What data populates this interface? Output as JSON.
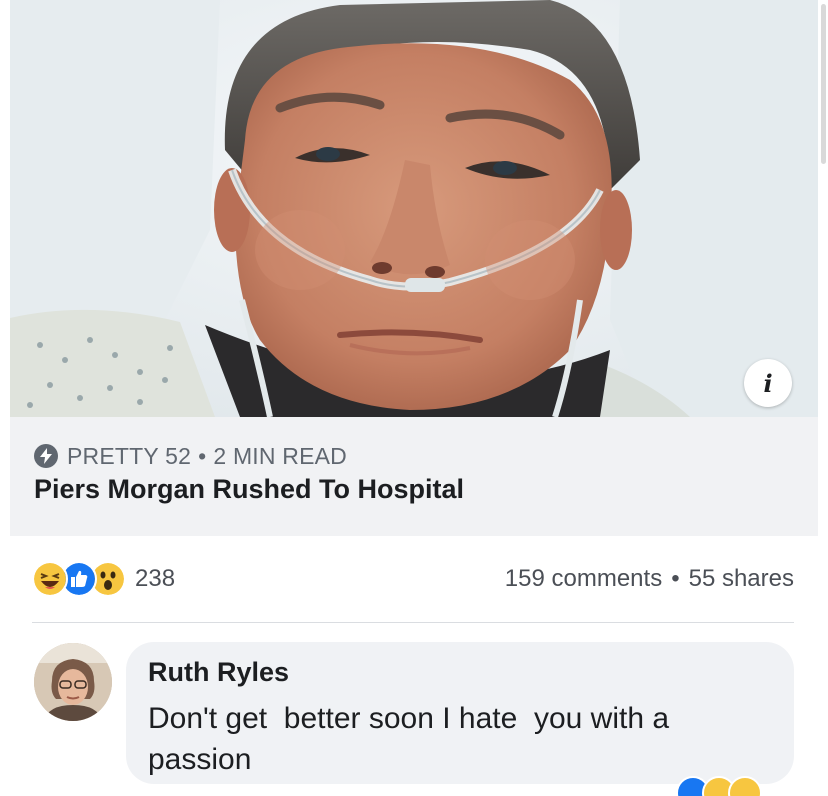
{
  "link_preview": {
    "source": "PRETTY 52",
    "separator": "•",
    "read_time": "2 MIN READ",
    "headline": "Piers Morgan Rushed To Hospital",
    "info_glyph": "i",
    "source_icon": "lightning-bolt-icon"
  },
  "reactions": {
    "icons": [
      "haha-emoji-icon",
      "like-thumb-icon",
      "wow-emoji-icon"
    ],
    "count": "238"
  },
  "stats": {
    "comments": "159 comments",
    "separator": "•",
    "shares": "55 shares"
  },
  "comment": {
    "author": "Ruth Ryles",
    "text": "Don't get  better soon I hate  you with a\npassion",
    "reaction_icons": [
      "like-thumb-icon",
      "haha-emoji-icon",
      "wow-emoji-icon"
    ]
  },
  "colors": {
    "card_background": "#f1f2f4",
    "meta_text": "#606770",
    "headline_text": "#1c1e21",
    "like_blue": "#1877f2",
    "emoji_yellow": "#f7c640",
    "comment_bubble": "#f0f2f5"
  }
}
